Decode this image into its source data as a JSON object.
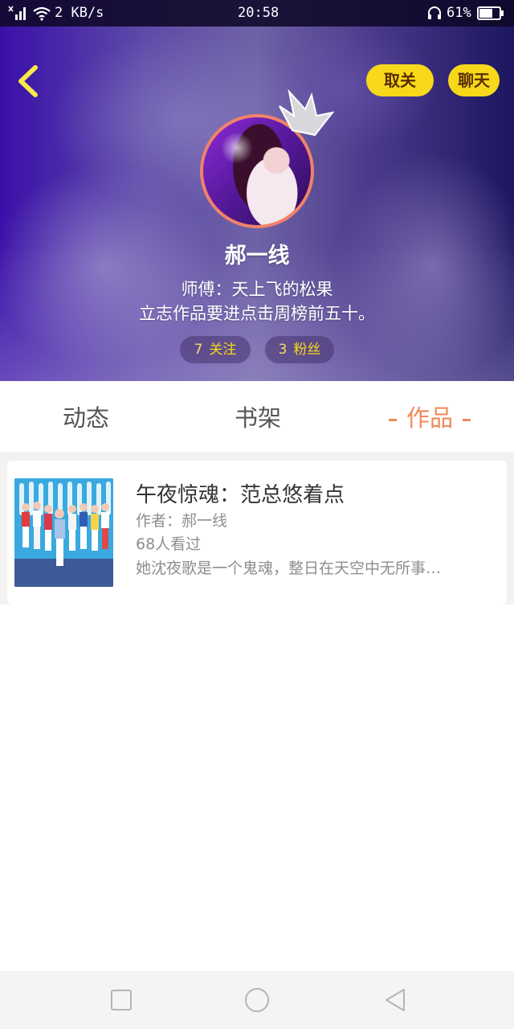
{
  "status_bar": {
    "network_speed": "2 KB/s",
    "time": "20:58",
    "battery_percent": "61%",
    "icons": [
      "signal-icon",
      "wifi-icon",
      "headphone-icon",
      "battery-icon"
    ]
  },
  "header": {
    "back_icon": "chevron-left-icon",
    "unfollow_label": "取关",
    "chat_label": "聊天",
    "crown_icon": "crown-icon",
    "username": "郝一线",
    "mentor": "师傅：天上飞的松果",
    "bio": "立志作品要进点击周榜前五十。",
    "following": {
      "count": "7",
      "label": "关注"
    },
    "followers": {
      "count": "3",
      "label": "粉丝"
    }
  },
  "tabs": {
    "items": [
      {
        "label": "动态",
        "active": false
      },
      {
        "label": "书架",
        "active": false
      },
      {
        "label": "作品",
        "active": true
      }
    ]
  },
  "works": [
    {
      "title": "午夜惊魂：范总悠着点",
      "author": "作者：郝一线",
      "views": "68人看过",
      "description": "她沈夜歌是一个鬼魂，整日在天空中无所事…"
    }
  ],
  "nav_bar": {
    "icons": [
      "recent-apps-icon",
      "home-icon",
      "back-icon"
    ]
  },
  "colors": {
    "accent_yellow": "#f7d81a",
    "active_tab": "#ef8a5a",
    "avatar_ring": "#f0836a"
  }
}
